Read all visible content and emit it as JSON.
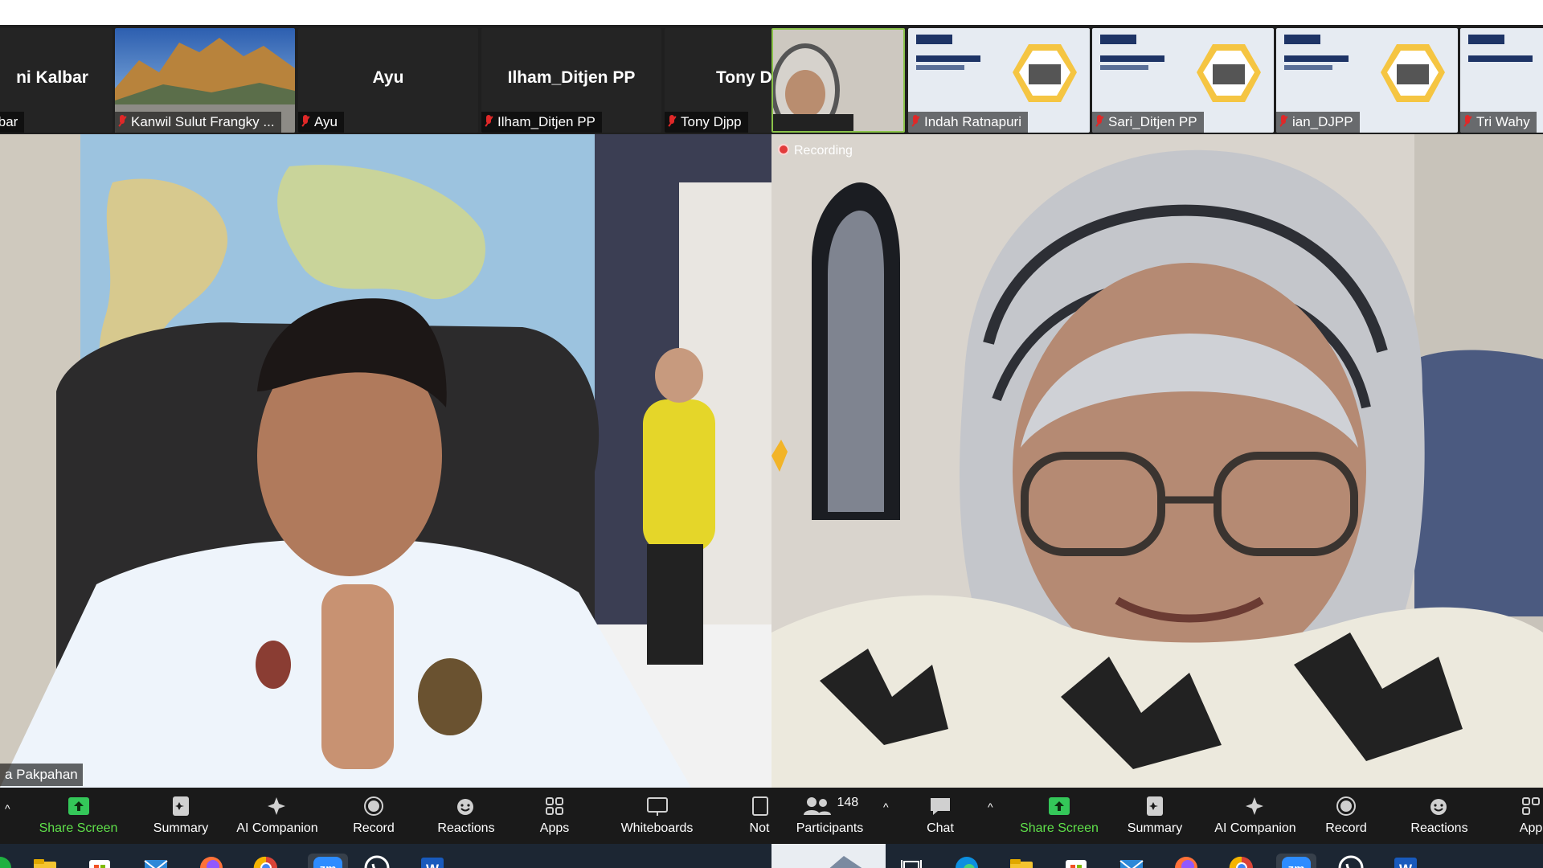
{
  "left": {
    "tiles": [
      {
        "name": "ni Kalbar",
        "label": "lbar"
      },
      {
        "name": "",
        "label": "Kanwil Sulut Frangky ..."
      },
      {
        "name": "Ayu",
        "label": "Ayu"
      },
      {
        "name": "Ilham_Ditjen PP",
        "label": "Ilham_Ditjen PP"
      },
      {
        "name": "Tony D",
        "label": "Tony Djpp"
      }
    ],
    "speaker_name": "a Pakpahan",
    "toolbar": {
      "share_screen": "Share Screen",
      "summary": "Summary",
      "ai_companion": "AI Companion",
      "record": "Record",
      "reactions": "Reactions",
      "apps": "Apps",
      "whiteboards": "Whiteboards",
      "notes": "Not"
    }
  },
  "right": {
    "tiles": [
      {
        "label": ""
      },
      {
        "label": "Indah Ratnapuri"
      },
      {
        "label": "Sari_Ditjen PP"
      },
      {
        "label": "ian_DJPP"
      },
      {
        "label": "Tri Wahy"
      }
    ],
    "recording": "Recording",
    "toolbar": {
      "participants_count": "148",
      "participants": "Participants",
      "chat": "Chat",
      "share_screen": "Share Screen",
      "summary": "Summary",
      "ai_companion": "AI Companion",
      "record": "Record",
      "reactions": "Reactions",
      "apps": "App"
    }
  },
  "colors": {
    "accent_green": "#5fe04a",
    "muted_red": "#e02828",
    "toolbar_bg": "#1a1a1a",
    "taskbar_bg": "#1c2633"
  }
}
